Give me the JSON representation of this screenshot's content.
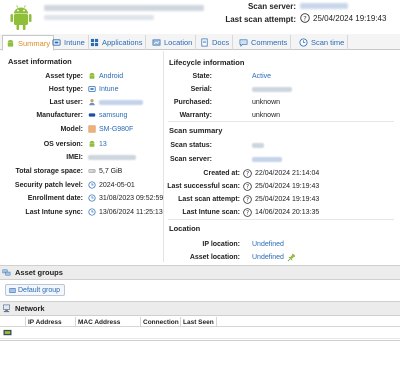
{
  "header": {
    "scan_server_label": "Scan server:",
    "last_attempt_label": "Last scan attempt:",
    "last_attempt_value": "25/04/2024 19:19:43"
  },
  "tabs": [
    {
      "label": "Summary",
      "icon": "android-icon",
      "active": true
    },
    {
      "label": "Intune",
      "icon": "intune-icon"
    },
    {
      "label": "Applications",
      "icon": "grid-icon"
    },
    {
      "label": "Location",
      "icon": "location-icon"
    },
    {
      "label": "Docs",
      "icon": "docs-icon"
    },
    {
      "label": "Comments",
      "icon": "comments-icon"
    },
    {
      "label": "Scan time",
      "icon": "clock-icon"
    }
  ],
  "asset_info": {
    "title": "Asset information",
    "rows": [
      {
        "label": "Asset type:",
        "value": "Android",
        "link": true,
        "icon": "android-icon"
      },
      {
        "label": "Host type:",
        "value": "Intune",
        "link": true,
        "icon": "intune-icon"
      },
      {
        "label": "Last user:",
        "value": "",
        "icon": "user-icon"
      },
      {
        "label": "Manufacturer:",
        "value": "samsung",
        "link": true,
        "icon": "manufacturer-icon"
      },
      {
        "label": "Model:",
        "value": "SM-G980F",
        "link": true,
        "icon": "model-icon"
      },
      {
        "label": "OS version:",
        "value": "13",
        "link": true,
        "icon": "android-icon"
      },
      {
        "label": "IMEI:",
        "value": ""
      },
      {
        "label": "Total storage space:",
        "value": "5,7 GiB",
        "icon": "storage-icon"
      },
      {
        "label": "Security patch level:",
        "value": "2024-05-01",
        "icon": "clock-icon"
      },
      {
        "label": "Enrollment date:",
        "value": "31/08/2023 09:52:59",
        "icon": "clock-icon"
      },
      {
        "label": "Last Intune sync:",
        "value": "13/06/2024 11:25:13",
        "icon": "clock-icon"
      }
    ]
  },
  "lifecycle": {
    "title": "Lifecycle information",
    "rows": [
      {
        "label": "State:",
        "value": "Active",
        "link": true
      },
      {
        "label": "Serial:",
        "value": ""
      },
      {
        "label": "Purchased:",
        "value": "unknown"
      },
      {
        "label": "Warranty:",
        "value": "unknown"
      }
    ]
  },
  "scan_summary": {
    "title": "Scan summary",
    "rows": [
      {
        "label": "Scan status:",
        "value": ""
      },
      {
        "label": "Scan server:",
        "value": ""
      },
      {
        "label": "Created at:",
        "value": "22/04/2024 21:14:04",
        "icon": "help-icon"
      },
      {
        "label": "Last successful scan:",
        "value": "25/04/2024 19:19:43",
        "icon": "help-icon"
      },
      {
        "label": "Last scan attempt:",
        "value": "25/04/2024 19:19:43",
        "icon": "help-icon"
      },
      {
        "label": "Last Intune scan:",
        "value": "14/06/2024 20:13:35",
        "icon": "help-icon"
      }
    ]
  },
  "location": {
    "title": "Location",
    "rows": [
      {
        "label": "IP location:",
        "value": "Undefined",
        "link": true
      },
      {
        "label": "Asset location:",
        "value": "Undefined",
        "link": true,
        "icon": "pin-icon"
      }
    ]
  },
  "asset_groups": {
    "title": "Asset groups",
    "button": "Default group"
  },
  "network": {
    "title": "Network",
    "columns": [
      "IP Address",
      "MAC Address",
      "Connection",
      "Last Seen"
    ]
  },
  "colors": {
    "link": "#2a6bb5",
    "active_tab": "#e08a1e",
    "android_green": "#8fbf3a"
  }
}
